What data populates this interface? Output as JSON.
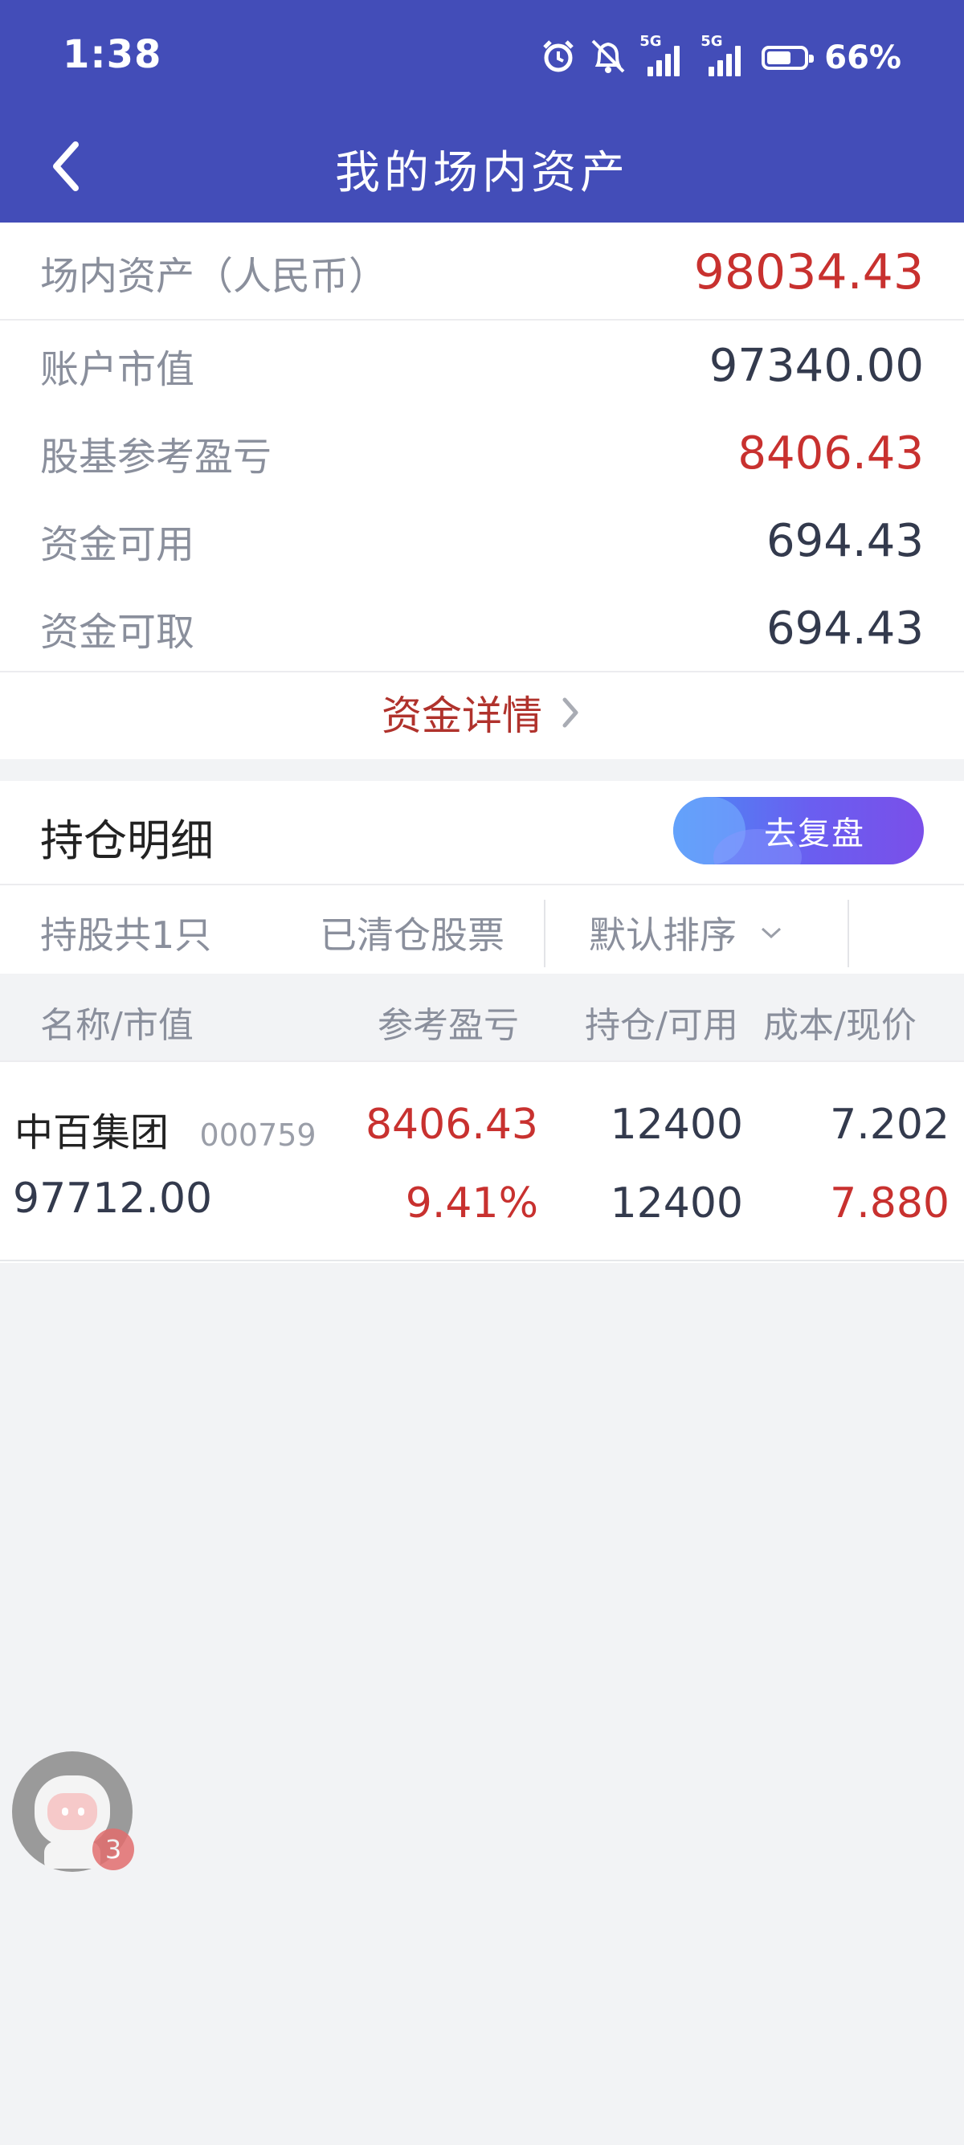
{
  "status_bar": {
    "time": "1:38",
    "net1": "5G",
    "net2": "5G",
    "battery_pct": "66%"
  },
  "nav": {
    "title": "我的场内资产"
  },
  "assets": {
    "total_label": "场内资产（人民币）",
    "total_value": "98034.43",
    "rows": [
      {
        "label": "账户市值",
        "value": "97340.00"
      },
      {
        "label": "股基参考盈亏",
        "value": "8406.43"
      },
      {
        "label": "资金可用",
        "value": "694.43"
      },
      {
        "label": "资金可取",
        "value": "694.43"
      }
    ],
    "detail_link": "资金详情"
  },
  "holdings": {
    "title": "持仓明细",
    "replay_button": "去复盘",
    "filters": {
      "count": "持股共1只",
      "cleared": "已清仓股票",
      "sort": "默认排序"
    },
    "headers": {
      "name": "名称/市值",
      "pnl": "参考盈亏",
      "position": "持仓/可用",
      "cost": "成本/现价"
    },
    "rows": [
      {
        "name": "中百集团",
        "code": "000759",
        "market_value": "97712.00",
        "pnl": "8406.43",
        "pnl_pct": "9.41%",
        "position": "12400",
        "available": "12400",
        "cost": "7.202",
        "price": "7.880"
      }
    ]
  },
  "assistant": {
    "badge": "3"
  },
  "colors": {
    "header": "#434db8",
    "red": "#c8312f",
    "label_gray": "#8a8f9c"
  }
}
